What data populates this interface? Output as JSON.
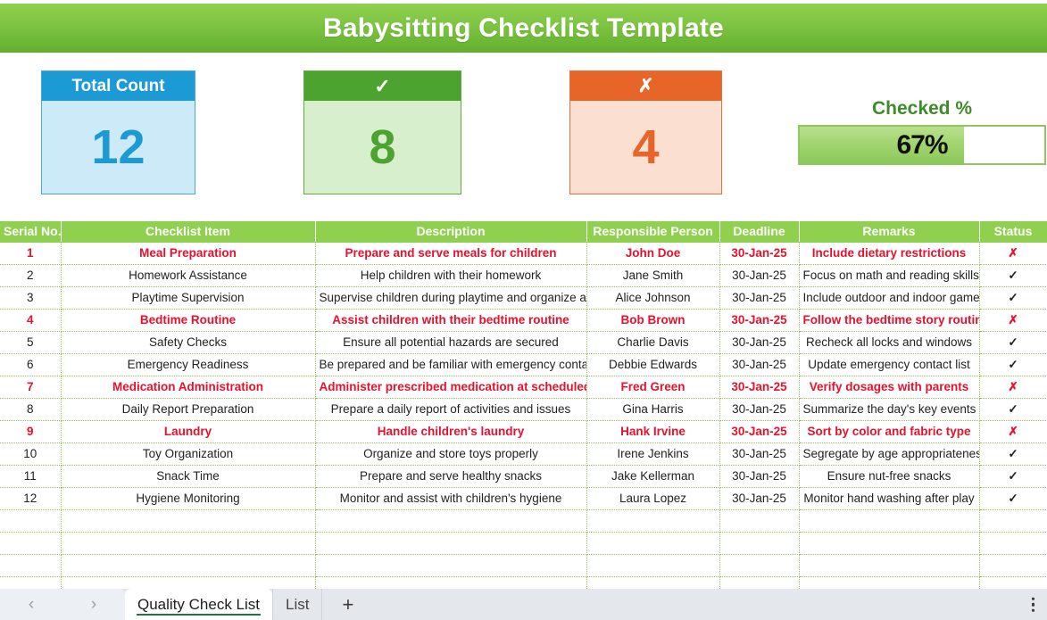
{
  "banner": {
    "title": "Babysitting Checklist Template"
  },
  "kpis": [
    {
      "name": "total-count",
      "label": "Total Count",
      "value": "12"
    },
    {
      "name": "checked-count",
      "label": "✓",
      "value": "8"
    },
    {
      "name": "unchecked-count",
      "label": "✗",
      "value": "4"
    }
  ],
  "gauge": {
    "label": "Checked %",
    "value": "67%",
    "percent": 67
  },
  "table": {
    "columns": [
      "Serial No.",
      "Checklist Item",
      "Description",
      "Responsible Person",
      "Deadline",
      "Remarks",
      "Status"
    ],
    "rows": [
      {
        "serial": "1",
        "item": "Meal Preparation",
        "description": "Prepare and serve meals for children",
        "person": "John Doe",
        "deadline": "30-Jan-25",
        "remarks": "Include dietary restrictions",
        "status": "✗",
        "highlight": true
      },
      {
        "serial": "2",
        "item": "Homework Assistance",
        "description": "Help children with their homework",
        "person": "Jane Smith",
        "deadline": "30-Jan-25",
        "remarks": "Focus on math and reading skills",
        "status": "✓",
        "highlight": false
      },
      {
        "serial": "3",
        "item": "Playtime Supervision",
        "description": "Supervise children during playtime and organize activities",
        "person": "Alice Johnson",
        "deadline": "30-Jan-25",
        "remarks": "Include outdoor and indoor games",
        "status": "✓",
        "highlight": false
      },
      {
        "serial": "4",
        "item": "Bedtime Routine",
        "description": "Assist children with their bedtime routine",
        "person": "Bob Brown",
        "deadline": "30-Jan-25",
        "remarks": "Follow the bedtime story routine",
        "status": "✗",
        "highlight": true
      },
      {
        "serial": "5",
        "item": "Safety Checks",
        "description": "Ensure all potential hazards are secured",
        "person": "Charlie Davis",
        "deadline": "30-Jan-25",
        "remarks": "Recheck all locks and windows",
        "status": "✓",
        "highlight": false
      },
      {
        "serial": "6",
        "item": "Emergency Readiness",
        "description": "Be prepared and be familiar with emergency contacts and procedures",
        "person": "Debbie Edwards",
        "deadline": "30-Jan-25",
        "remarks": "Update emergency contact list",
        "status": "✓",
        "highlight": false
      },
      {
        "serial": "7",
        "item": "Medication Administration",
        "description": "Administer prescribed medication at scheduled times",
        "person": "Fred Green",
        "deadline": "30-Jan-25",
        "remarks": "Verify dosages with parents",
        "status": "✗",
        "highlight": true
      },
      {
        "serial": "8",
        "item": "Daily Report Preparation",
        "description": "Prepare a daily report of activities and issues",
        "person": "Gina Harris",
        "deadline": "30-Jan-25",
        "remarks": "Summarize the day's key events",
        "status": "✓",
        "highlight": false
      },
      {
        "serial": "9",
        "item": "Laundry",
        "description": "Handle children's laundry",
        "person": "Hank Irvine",
        "deadline": "30-Jan-25",
        "remarks": "Sort by color and fabric type",
        "status": "✗",
        "highlight": true
      },
      {
        "serial": "10",
        "item": "Toy Organization",
        "description": "Organize and store toys properly",
        "person": "Irene Jenkins",
        "deadline": "30-Jan-25",
        "remarks": "Segregate by age appropriateness",
        "status": "✓",
        "highlight": false
      },
      {
        "serial": "11",
        "item": "Snack Time",
        "description": "Prepare and serve healthy snacks",
        "person": "Jake Kellerman",
        "deadline": "30-Jan-25",
        "remarks": "Ensure nut-free snacks",
        "status": "✓",
        "highlight": false
      },
      {
        "serial": "12",
        "item": "Hygiene Monitoring",
        "description": "Monitor and assist with children's hygiene",
        "person": "Laura Lopez",
        "deadline": "30-Jan-25",
        "remarks": "Monitor hand washing after play",
        "status": "✓",
        "highlight": false
      }
    ],
    "empty_row_count": 4
  },
  "tabbar": {
    "prev_label": "‹",
    "next_label": "›",
    "tabs": [
      {
        "label": "Quality Check List",
        "active": true
      },
      {
        "label": "List",
        "active": false
      }
    ],
    "add_label": "+"
  },
  "colors": {
    "banner_green": "#7ec342",
    "header_green": "#8fd14f",
    "blue": "#1b9ad6",
    "green": "#4ca32f",
    "orange": "#e8652a",
    "highlight_red": "#e8112d",
    "check_green": "#1f9d4e"
  }
}
